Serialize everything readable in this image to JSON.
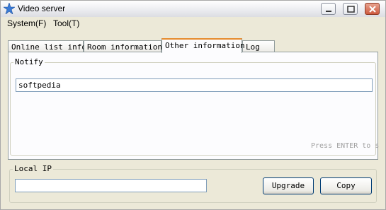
{
  "window": {
    "title": "Video server"
  },
  "menu": {
    "items": [
      {
        "label": "System(F)"
      },
      {
        "label": "Tool(T)"
      }
    ]
  },
  "tabs": [
    {
      "label": "Online list info"
    },
    {
      "label": "Room information"
    },
    {
      "label": "Other information",
      "active": true
    },
    {
      "label": "Log"
    }
  ],
  "notify": {
    "group_label": "Notify",
    "input_value": "softpedia",
    "hint": "Press ENTER to s"
  },
  "local_ip": {
    "group_label": "Local IP",
    "input_value": ""
  },
  "buttons": {
    "upgrade": "Upgrade",
    "copy": "Copy"
  },
  "colors": {
    "active_tab_accent": "#e68b2c",
    "close_button": "#cd5a3f",
    "input_border": "#7f9db9"
  }
}
